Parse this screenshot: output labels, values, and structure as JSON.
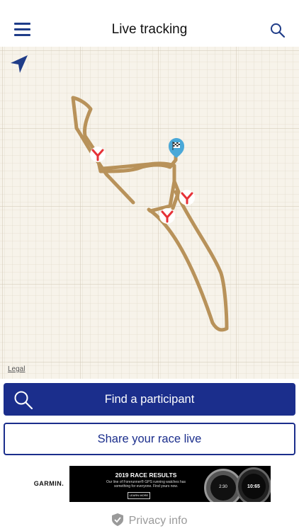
{
  "header": {
    "title": "Live tracking"
  },
  "map": {
    "legal_label": "Legal"
  },
  "actions": {
    "find_participant": "Find a participant",
    "share_race": "Share your race live"
  },
  "ad": {
    "brand": "GARMIN.",
    "title": "2019 RACE RESULTS",
    "body": "Our line of Forerunner® GPS running watches has something for everyone. Find yours now.",
    "cta": "LEARN MORE",
    "watch1_time": "2:30",
    "watch2_time": "10:65"
  },
  "footer": {
    "privacy_label": "Privacy info"
  },
  "colors": {
    "accent": "#1b2e8c",
    "route": "#b8925a",
    "marker": "#e63238",
    "finish_pin": "#4aa8d8"
  }
}
